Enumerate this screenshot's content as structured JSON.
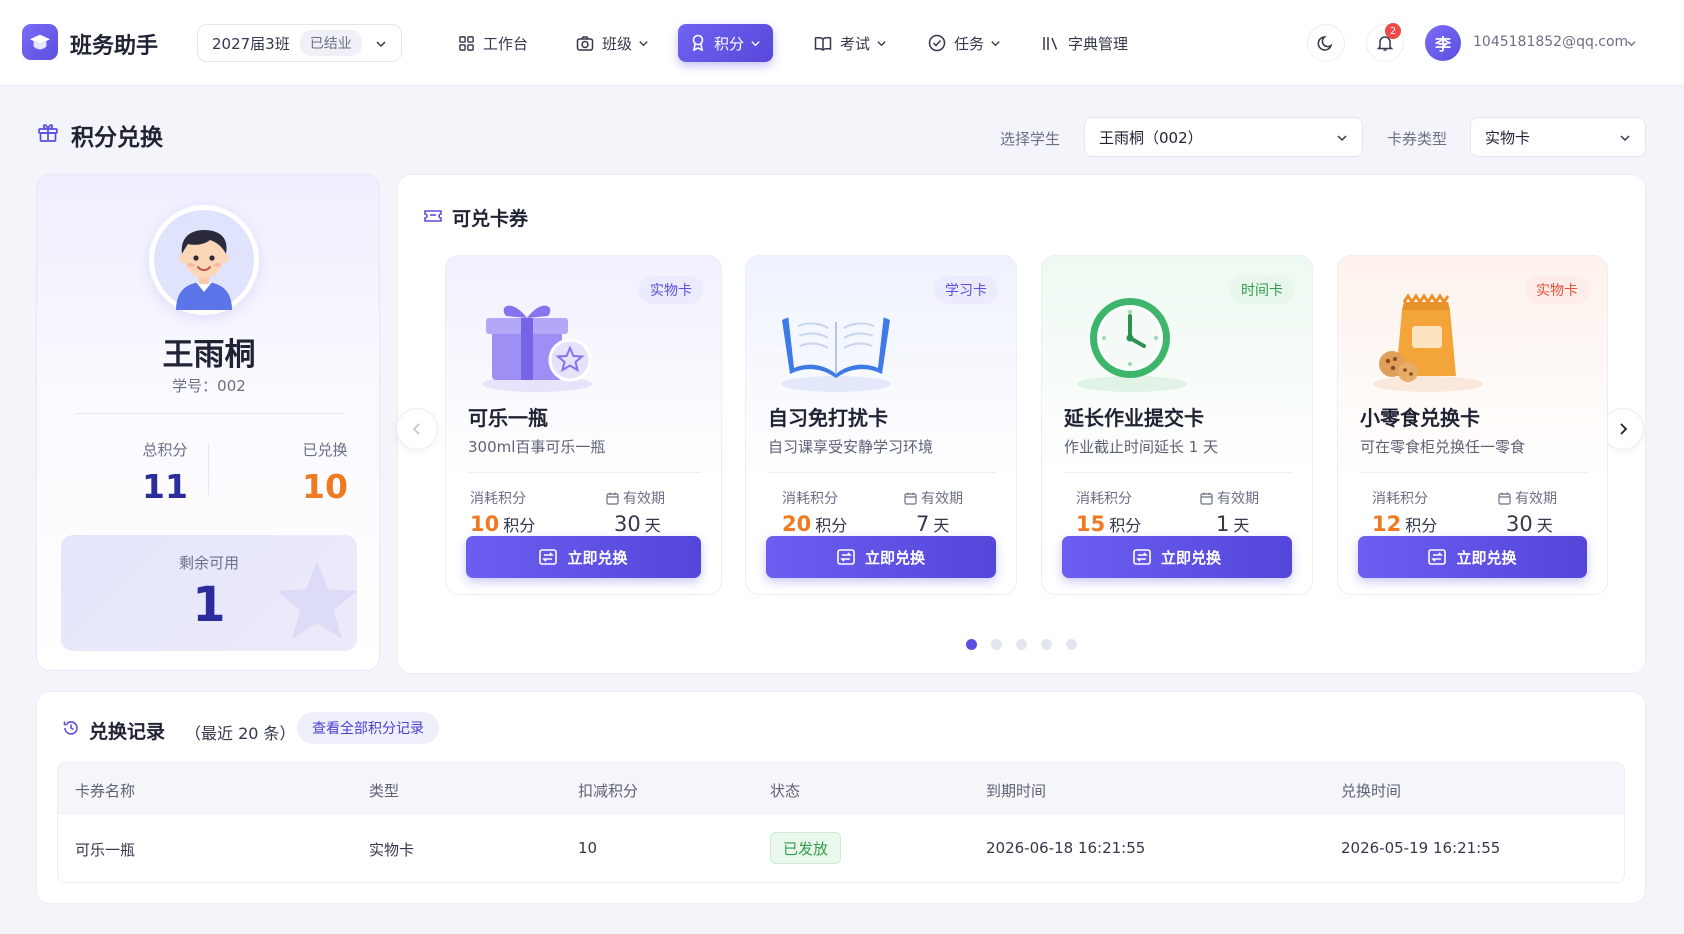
{
  "app": {
    "title": "班务助手"
  },
  "class_select": {
    "value": "2027届3班",
    "badge": "已结业"
  },
  "nav": [
    {
      "label": "工作台",
      "icon": "grid-icon",
      "has_dropdown": false,
      "active": false
    },
    {
      "label": "班级",
      "icon": "camera-icon",
      "has_dropdown": true,
      "active": false
    },
    {
      "label": "积分",
      "icon": "medal-icon",
      "has_dropdown": true,
      "active": true
    },
    {
      "label": "考试",
      "icon": "book-open-icon",
      "has_dropdown": true,
      "active": false
    },
    {
      "label": "任务",
      "icon": "check-circle-icon",
      "has_dropdown": true,
      "active": false
    },
    {
      "label": "字典管理",
      "icon": "library-icon",
      "has_dropdown": false,
      "active": false
    }
  ],
  "header_actions": {
    "notification_count": "2",
    "user_avatar_text": "李",
    "user_email": "1045181852@qq.com"
  },
  "page": {
    "title": "积分兑换",
    "filters": {
      "student_label": "选择学生",
      "student_value": "王雨桐（002）",
      "type_label": "卡券类型",
      "type_value": "实物卡"
    }
  },
  "student": {
    "name": "王雨桐",
    "id_text": "学号：002",
    "total_label": "总积分",
    "total_value": "11",
    "redeemed_label": "已兑换",
    "redeemed_value": "10",
    "remaining_label": "剩余可用",
    "remaining_value": "1"
  },
  "coupons": {
    "title": "可兑卡券",
    "cost_label": "消耗积分",
    "validity_label": "有效期",
    "points_unit": "积分",
    "days_unit": "天",
    "button_label": "立即兑换",
    "items": [
      {
        "tag": "实物卡",
        "name": "可乐一瓶",
        "desc": "300ml百事可乐一瓶",
        "cost": "10",
        "days": "30",
        "image": "gift-box"
      },
      {
        "tag": "学习卡",
        "name": "自习免打扰卡",
        "desc": "自习课享受安静学习环境",
        "cost": "20",
        "days": "7",
        "image": "open-book"
      },
      {
        "tag": "时间卡",
        "name": "延长作业提交卡",
        "desc": "作业截止时间延长 1 天",
        "cost": "15",
        "days": "1",
        "image": "alarm-clock"
      },
      {
        "tag": "实物卡",
        "name": "小零食兑换卡",
        "desc": "可在零食柜兑换任一零食",
        "cost": "12",
        "days": "30",
        "image": "snack-bag"
      }
    ],
    "pager": {
      "total": 5,
      "current": 1
    }
  },
  "colors": {
    "accent": "#5a4fe0",
    "points_orange": "#f07a22",
    "total_blue": "#2b2d9c",
    "tag_purple": "#5a4fe0",
    "tag_green": "#2f9e4a",
    "tag_red": "#e0533d",
    "status_green": "#2f9e4a"
  },
  "records": {
    "title": "兑换记录",
    "subtitle": "（最近 20 条）",
    "link": "查看全部积分记录",
    "columns": [
      "卡券名称",
      "类型",
      "扣减积分",
      "状态",
      "到期时间",
      "兑换时间"
    ],
    "rows": [
      [
        "可乐一瓶",
        "实物卡",
        "10",
        "已发放",
        "2026-06-18 16:21:55",
        "2026-05-19 16:21:55"
      ]
    ]
  }
}
